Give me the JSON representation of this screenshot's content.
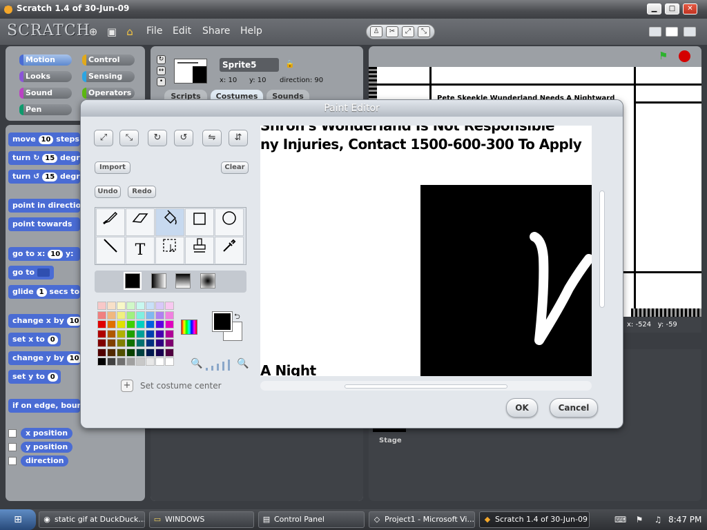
{
  "window": {
    "title": "Scratch 1.4 of 30-Jun-09",
    "min": "▁",
    "max": "□",
    "close": "✕"
  },
  "menubar": {
    "logo": "SCRATCH",
    "menus": [
      "File",
      "Edit",
      "Share",
      "Help"
    ],
    "globe_icon": "⊕",
    "save_icon": "▣",
    "share_icon": "⌂",
    "tools": [
      "♙",
      "✂",
      "⤢",
      "⤡"
    ]
  },
  "categories": [
    {
      "label": "Motion",
      "color": "#4a6cd4",
      "selected": true
    },
    {
      "label": "Control",
      "color": "#e1a91a"
    },
    {
      "label": "Looks",
      "color": "#8a55d7"
    },
    {
      "label": "Sensing",
      "color": "#2ca5e2"
    },
    {
      "label": "Sound",
      "color": "#bb42c3"
    },
    {
      "label": "Operators",
      "color": "#5cb712"
    },
    {
      "label": "Pen",
      "color": "#0e9a6c"
    }
  ],
  "blocks": {
    "move": {
      "pre": "move",
      "num": "10",
      "post": "steps"
    },
    "turn_cw": {
      "pre": "turn ↻",
      "num": "15",
      "post": "degr"
    },
    "turn_ccw": {
      "pre": "turn ↺",
      "num": "15",
      "post": "degr"
    },
    "point_dir": "point in direction",
    "point_towards": "point towards",
    "goto_xy": {
      "pre": "go to x:",
      "num": "10",
      "post": "y:"
    },
    "goto": "go to",
    "glide": {
      "pre": "glide",
      "num": "1",
      "post": "secs to"
    },
    "change_x": {
      "pre": "change x by",
      "num": "10"
    },
    "set_x": {
      "pre": "set x to",
      "num": "0"
    },
    "change_y": {
      "pre": "change y by",
      "num": "10"
    },
    "set_y": {
      "pre": "set y to",
      "num": "0"
    },
    "bounce": "if on edge, bounce",
    "reporters": [
      "x position",
      "y position",
      "direction"
    ]
  },
  "sprite": {
    "name": "Sprite5",
    "x": "x: 10",
    "y": "y: 10",
    "direction": "direction: 90",
    "tabs": [
      "Scripts",
      "Costumes",
      "Sounds"
    ],
    "lock_icon": "🔒"
  },
  "stage": {
    "readout_x": "x: -524",
    "readout_y": "y: -59",
    "stage_label": "Stage",
    "sign_text": "Pete Skeekle Wunderland Needs A Nightward"
  },
  "paint_editor": {
    "title": "Paint Editor",
    "transform_tools": [
      "⤢",
      "⤡",
      "↻",
      "↺",
      "⇋",
      "⇵"
    ],
    "import": "Import",
    "clear": "Clear",
    "undo": "Undo",
    "redo": "Redo",
    "tools": [
      "🖌",
      "▱",
      "🪣",
      "□",
      "○",
      "╲",
      "T",
      "⬚",
      "♙",
      "✎"
    ],
    "canvas_lines": [
      "Shron's Wonderland Is Not Responsible",
      "ny Injuries, Contact 1500-600-300 To Apply",
      "A Night"
    ],
    "set_center_label": "Set costume center",
    "set_center_icon": "+",
    "ok": "OK",
    "cancel": "Cancel",
    "zoom_out_icon": "🔍",
    "zoom_in_icon": "🔍",
    "swap_icon": "⮌"
  },
  "taskbar": {
    "start_icon": "⊞",
    "items": [
      {
        "label": "static gif at DuckDuck...",
        "icon": "◉"
      },
      {
        "label": "WINDOWS",
        "icon": "▭"
      },
      {
        "label": "Control Panel",
        "icon": "▤"
      },
      {
        "label": "Project1 - Microsoft Vi...",
        "icon": "◇"
      },
      {
        "label": "Scratch 1.4 of 30-Jun-09",
        "icon": "◆",
        "active": true
      }
    ],
    "clock": "8:47 PM",
    "tray": [
      "⌨",
      "⚑",
      "♫"
    ]
  }
}
